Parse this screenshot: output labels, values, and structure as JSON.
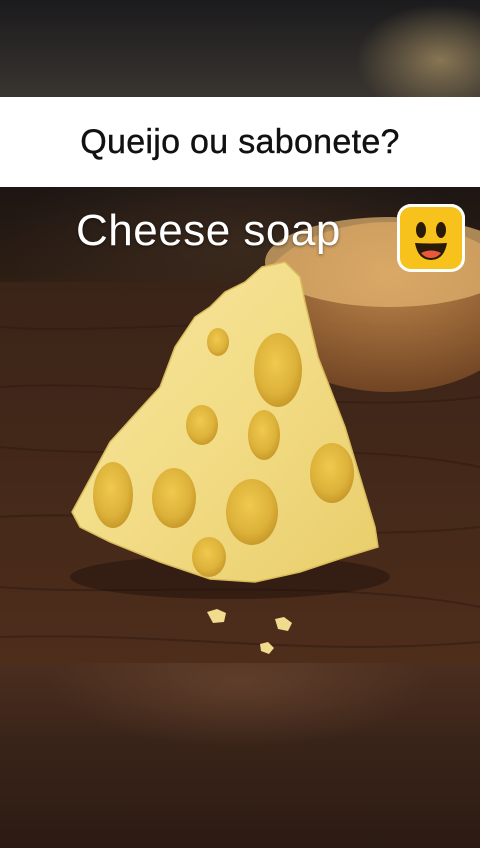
{
  "caption": "Queijo ou sabonete?",
  "overlay_text": "Cheese soap",
  "emoji_icon": "grinning-face-icon"
}
